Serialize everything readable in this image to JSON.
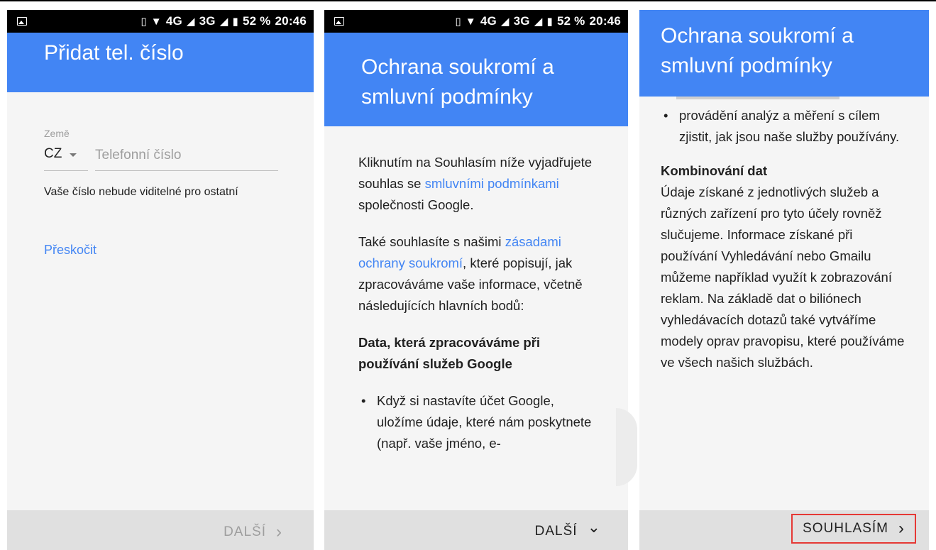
{
  "panel1": {
    "status": {
      "time": "20:46",
      "battery": "52 %",
      "network1": "4G",
      "network2": "3G"
    },
    "header": {
      "title": "Přidat tel. číslo"
    },
    "form": {
      "country_label": "Země",
      "country_value": "CZ",
      "phone_placeholder": "Telefonní číslo",
      "note": "Vaše číslo nebude viditelné pro ostatní"
    },
    "skip_label": "Přeskočit",
    "footer": {
      "next_label": "DALŠÍ",
      "next_icon": "›"
    }
  },
  "panel2": {
    "status": {
      "time": "20:46",
      "battery": "52 %",
      "network1": "4G",
      "network2": "3G"
    },
    "header": {
      "title": "Ochrana soukromí a smluvní podmínky"
    },
    "content": {
      "p1_before": "Kliknutím na Souhlasím níže vyjadřujete souhlas se ",
      "p1_link": "smluvními podmínkami",
      "p1_after": " společnosti Google.",
      "p2_before": "Také souhlasíte s našimi ",
      "p2_link": "zásadami ochrany soukromí",
      "p2_after": ", které popisují, jak zpracováváme vaše informace, včetně následujících hlavních bodů:",
      "heading": "Data, která zpracováváme při používání služeb Google",
      "bullet": "Když si nastavíte účet Google, uložíme údaje, které nám poskytnete (např. vaše jméno, e-"
    },
    "footer": {
      "next_label": "DALŠÍ",
      "next_icon": "⌄"
    }
  },
  "panel3": {
    "header": {
      "title": "Ochrana soukromí a smluvní podmínky"
    },
    "content": {
      "bullet": "provádění analýz a měření s cílem zjistit, jak jsou naše služby používány.",
      "heading": "Kombinování dat",
      "paragraph": "Údaje získané z jednotlivých služeb a různých zařízení pro tyto účely rovněž slučujeme. Informace získané při používání Vyhledávání nebo Gmailu můžeme například využít k zobrazování reklam. Na základě dat o biliónech vyhledávacích dotazů také vytváříme modely oprav pravopisu, které používáme ve všech našich službách."
    },
    "footer": {
      "agree_label": "SOUHLASÍM",
      "agree_icon": "›"
    }
  },
  "colors": {
    "accent": "#4285f4",
    "footer": "#e0e0e0",
    "highlight_border": "#e53935"
  }
}
